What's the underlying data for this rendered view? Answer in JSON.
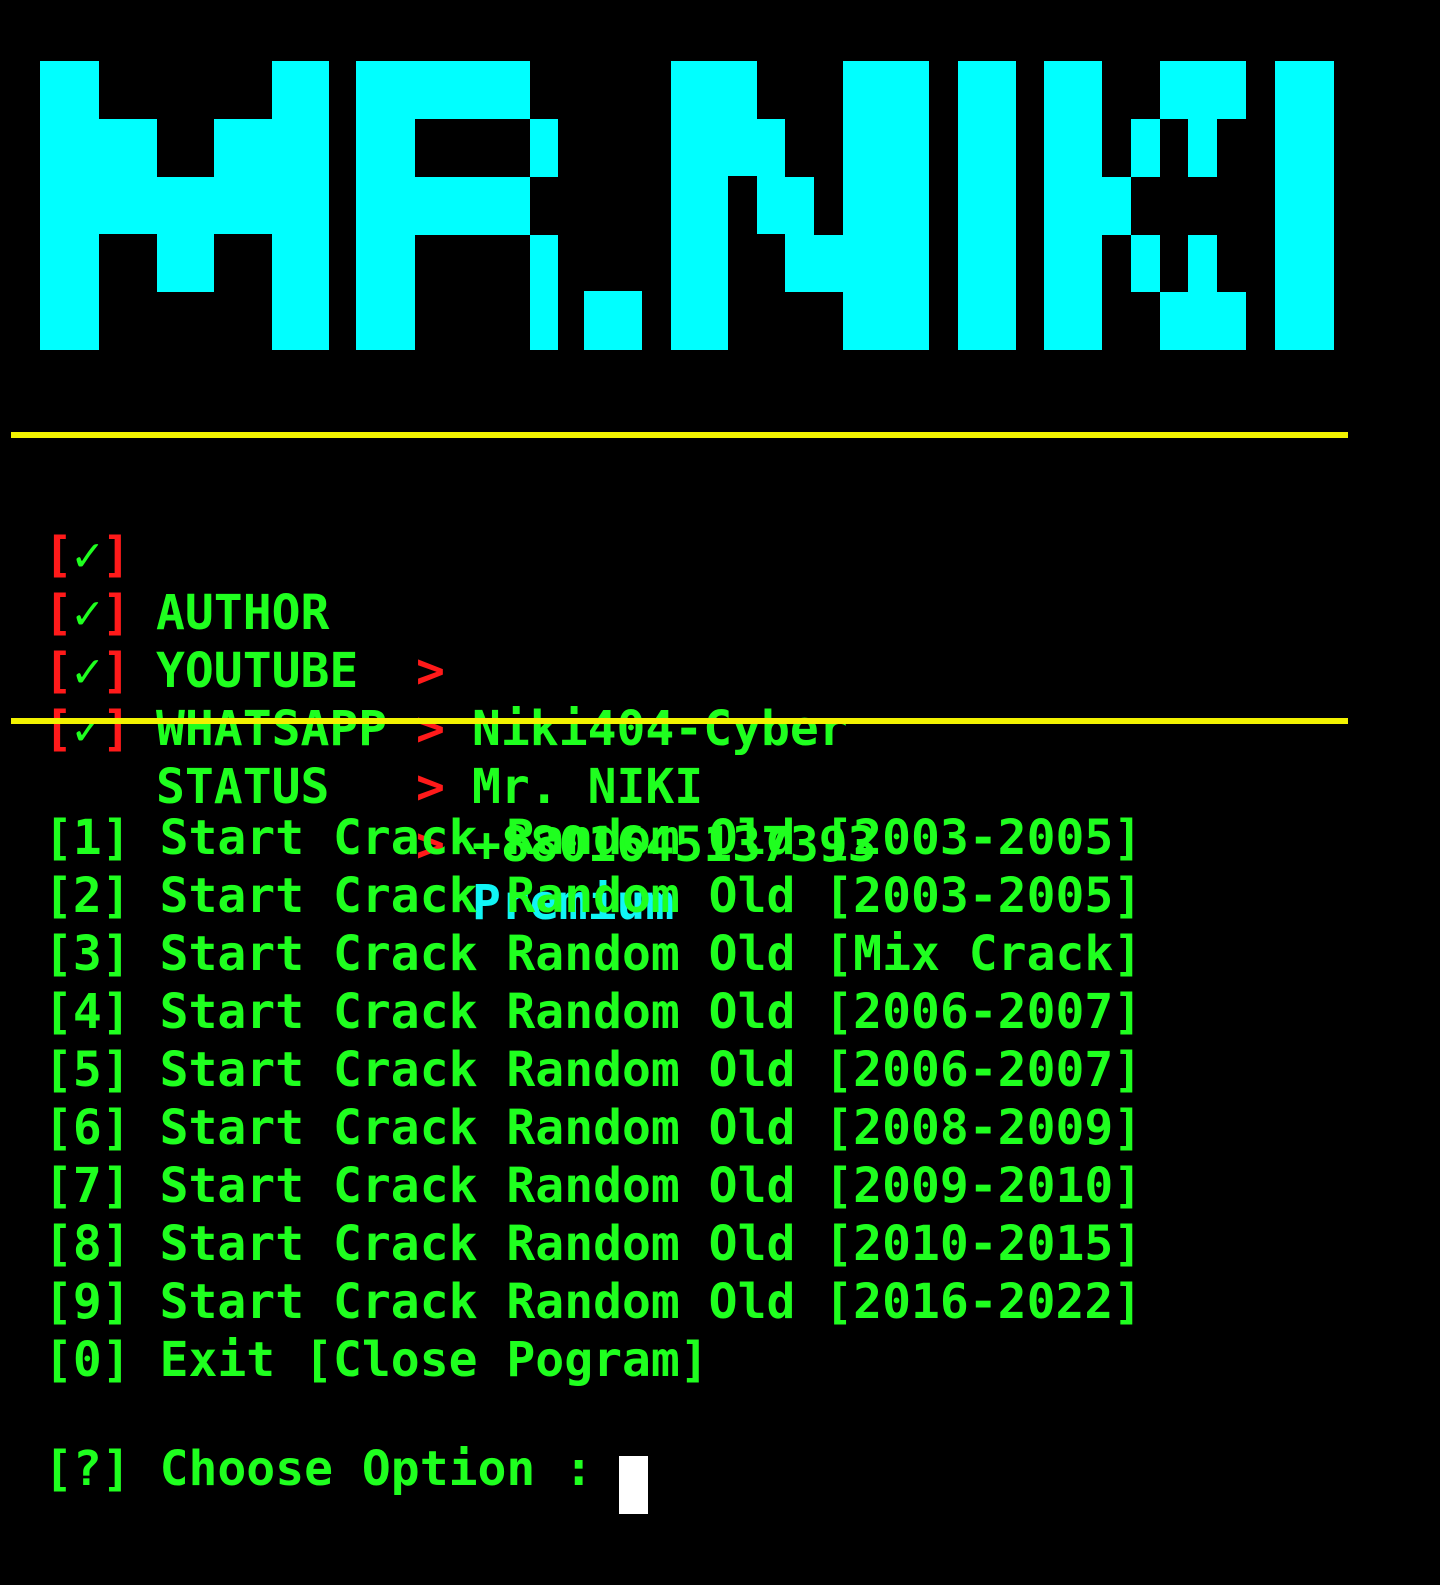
{
  "banner": {
    "text": "MR.NIKI",
    "color": "#00ffff"
  },
  "colors": {
    "background": "#000000",
    "text_green": "#1fff1f",
    "bracket_red": "#ff1a1a",
    "rule_yellow": "#f2f200",
    "accent_cyan": "#10f5f5"
  },
  "info": {
    "rows": [
      {
        "check": "✓",
        "label": "AUTHOR",
        "arrow": ">",
        "value": "Niki404-Cyber"
      },
      {
        "check": "✓",
        "label": "YOUTUBE",
        "arrow": ">",
        "value": "Mr. NIKI"
      },
      {
        "check": "✓",
        "label": "WHATSAPP",
        "arrow": ">",
        "value": "+8801645137393"
      },
      {
        "check": "✓",
        "label": "STATUS",
        "arrow": ">",
        "value": "Premium"
      }
    ]
  },
  "menu": {
    "items": [
      {
        "key": "1",
        "text": "Start Crack Random Old [2003-2005]"
      },
      {
        "key": "2",
        "text": "Start Crack Random Old [2003-2005]"
      },
      {
        "key": "3",
        "text": "Start Crack Random Old [Mix Crack]"
      },
      {
        "key": "4",
        "text": "Start Crack Random Old [2006-2007]"
      },
      {
        "key": "5",
        "text": "Start Crack Random Old [2006-2007]"
      },
      {
        "key": "6",
        "text": "Start Crack Random Old [2008-2009]"
      },
      {
        "key": "7",
        "text": "Start Crack Random Old [2009-2010]"
      },
      {
        "key": "8",
        "text": "Start Crack Random Old [2010-2015]"
      },
      {
        "key": "9",
        "text": "Start Crack Random Old [2016-2022]"
      },
      {
        "key": "0",
        "text": "Exit [Close Pogram]"
      }
    ]
  },
  "prompt": {
    "marker": "?",
    "text": "Choose Option :",
    "input_value": ""
  }
}
